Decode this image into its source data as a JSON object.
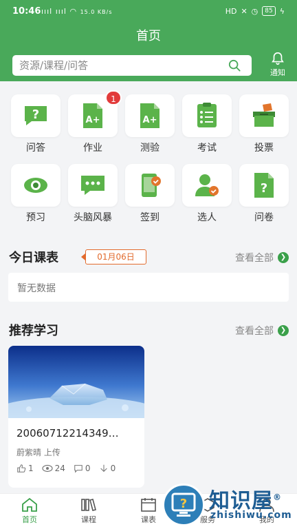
{
  "status_bar": {
    "time": "10:46",
    "signal": "ıııl ıııl",
    "speed": "15.0 KB/s",
    "hd": "HD",
    "battery": "85"
  },
  "header": {
    "title": "首页",
    "search_placeholder": "资源/课程/问答",
    "notify_label": "通知"
  },
  "apps": [
    {
      "label": "问答",
      "badge": ""
    },
    {
      "label": "作业",
      "badge": "1"
    },
    {
      "label": "测验",
      "badge": ""
    },
    {
      "label": "考试",
      "badge": ""
    },
    {
      "label": "投票",
      "badge": ""
    },
    {
      "label": "预习",
      "badge": ""
    },
    {
      "label": "头脑风暴",
      "badge": ""
    },
    {
      "label": "签到",
      "badge": ""
    },
    {
      "label": "选人",
      "badge": ""
    },
    {
      "label": "问卷",
      "badge": ""
    }
  ],
  "schedule": {
    "title": "今日课表",
    "date": "01月06日",
    "more": "查看全部",
    "empty": "暂无数据"
  },
  "recommend": {
    "title": "推荐学习",
    "more": "查看全部",
    "card": {
      "title": "20060712214349…",
      "author": "蔚紫晴 上传",
      "likes": "1",
      "views": "24",
      "comments": "0",
      "downloads": "0"
    }
  },
  "tabbar": {
    "items": [
      "首页",
      "课程",
      "课表",
      "服务",
      "我的"
    ]
  },
  "watermark": {
    "text": "知识屋",
    "sub": "zhishiwu.com",
    "registered": "®"
  },
  "colors": {
    "brand_green": "#49a95a",
    "badge_red": "#e23b3b",
    "date_orange": "#e26a2c"
  }
}
